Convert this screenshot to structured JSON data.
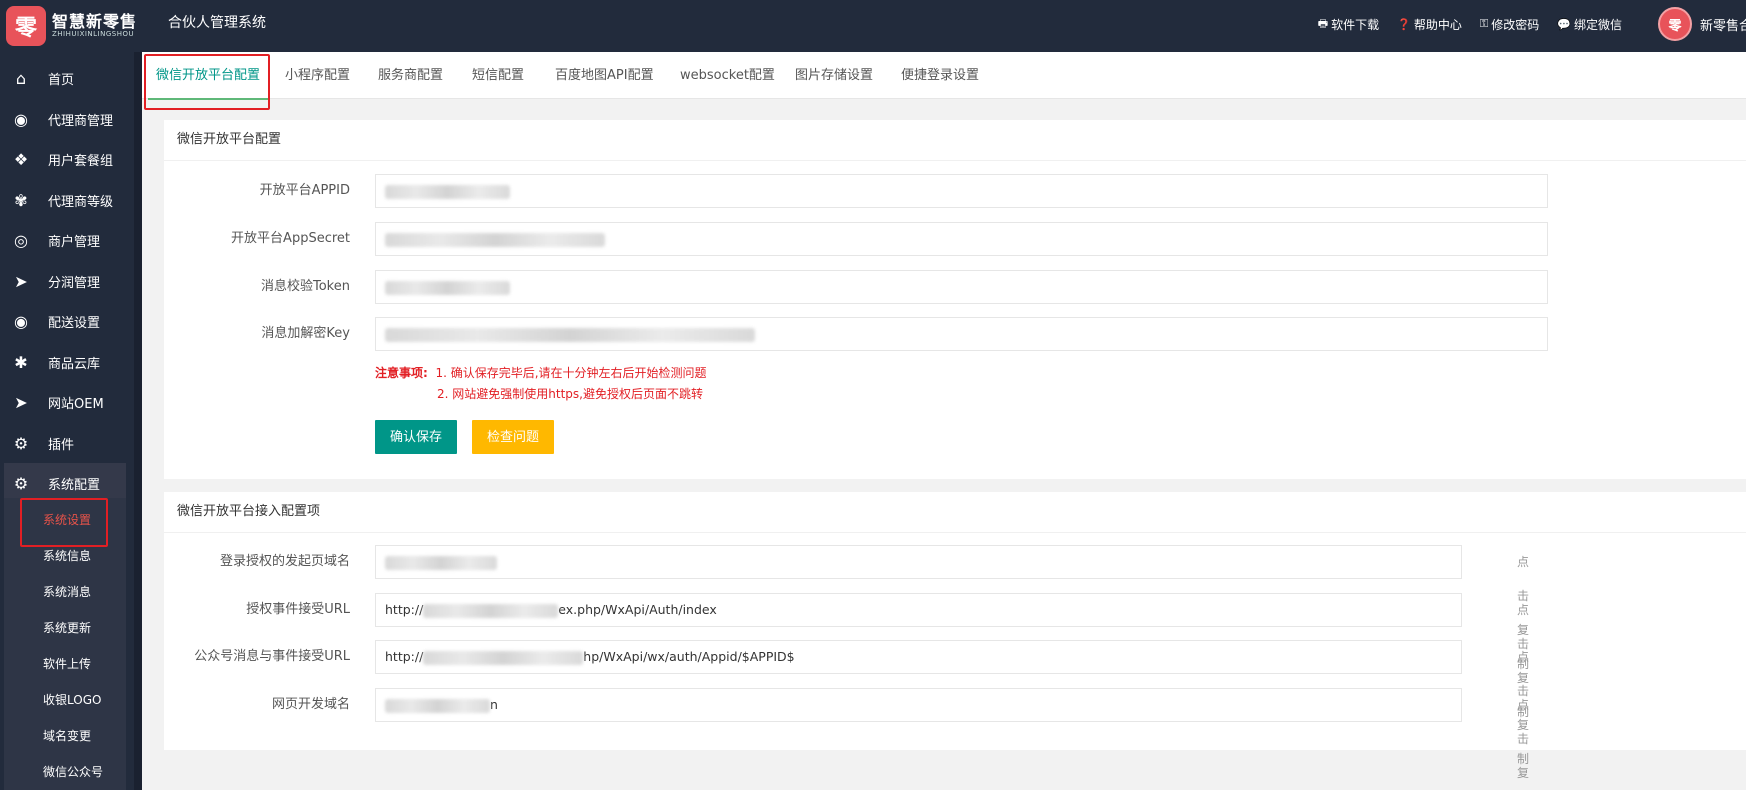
{
  "header": {
    "logo_text": "智慧新零售",
    "logo_subtext": "ZHIHUIXINLINGSHOU",
    "logo_glyph": "零",
    "system_title": "合伙人管理系统",
    "links": [
      {
        "icon": "printer-icon",
        "label": "软件下载"
      },
      {
        "icon": "help-icon",
        "label": "帮助中心"
      },
      {
        "icon": "key-icon",
        "label": "修改密码"
      },
      {
        "icon": "wechat-icon",
        "label": "绑定微信"
      }
    ],
    "avatar_glyph": "零",
    "user_name": "新零售合"
  },
  "sidebar": {
    "items": [
      {
        "icon": "home-icon",
        "label": "首页"
      },
      {
        "icon": "agent-icon",
        "label": "代理商管理"
      },
      {
        "icon": "package-icon",
        "label": "用户套餐组"
      },
      {
        "icon": "level-icon",
        "label": "代理商等级"
      },
      {
        "icon": "merchant-icon",
        "label": "商户管理"
      },
      {
        "icon": "share-icon",
        "label": "分润管理"
      },
      {
        "icon": "delivery-icon",
        "label": "配送设置"
      },
      {
        "icon": "asterisk-icon",
        "label": "商品云库"
      },
      {
        "icon": "oem-icon",
        "label": "网站OEM"
      },
      {
        "icon": "plugin-icon",
        "label": "插件"
      },
      {
        "icon": "gears-icon",
        "label": "系统配置"
      }
    ],
    "sub_items": [
      {
        "label": "系统设置",
        "active": true
      },
      {
        "label": "系统信息"
      },
      {
        "label": "系统消息"
      },
      {
        "label": "系统更新"
      },
      {
        "label": "软件上传"
      },
      {
        "label": "收银LOGO"
      },
      {
        "label": "域名变更"
      },
      {
        "label": "微信公众号"
      }
    ]
  },
  "tabs": [
    {
      "label": "微信开放平台配置",
      "active": true
    },
    {
      "label": "小程序配置"
    },
    {
      "label": "服务商配置"
    },
    {
      "label": "短信配置"
    },
    {
      "label": "百度地图API配置"
    },
    {
      "label": "websocket配置"
    },
    {
      "label": "图片存储设置"
    },
    {
      "label": "便捷登录设置"
    }
  ],
  "config_card": {
    "title": "微信开放平台配置",
    "fields": [
      {
        "label": "开放平台APPID"
      },
      {
        "label": "开放平台AppSecret"
      },
      {
        "label": "消息校验Token"
      },
      {
        "label": "消息加解密Key"
      }
    ],
    "notice_label": "注意事项:",
    "notice_lines": [
      "1. 确认保存完毕后,请在十分钟左右后开始检测问题",
      "2. 网站避免强制使用https,避免授权后页面不跳转"
    ],
    "save_button": "确认保存",
    "check_button": "检查问题"
  },
  "access_card": {
    "title": "微信开放平台接入配置项",
    "copy_label": "点击复制",
    "fields": [
      {
        "label": "登录授权的发起页域名",
        "prefix": "",
        "suffix": ""
      },
      {
        "label": "授权事件接受URL",
        "prefix": "http://",
        "suffix": "ex.php/WxApi/Auth/index"
      },
      {
        "label": "公众号消息与事件接受URL",
        "prefix": "http://",
        "suffix": "hp/WxApi/wx/auth/Appid/$APPID$"
      },
      {
        "label": "网页开发域名",
        "prefix": "",
        "suffix": "n"
      }
    ]
  },
  "colors": {
    "header_bg": "#222b3c",
    "accent_green": "#009688",
    "warning_yellow": "#ffb800",
    "notice_red": "#e21f24"
  }
}
